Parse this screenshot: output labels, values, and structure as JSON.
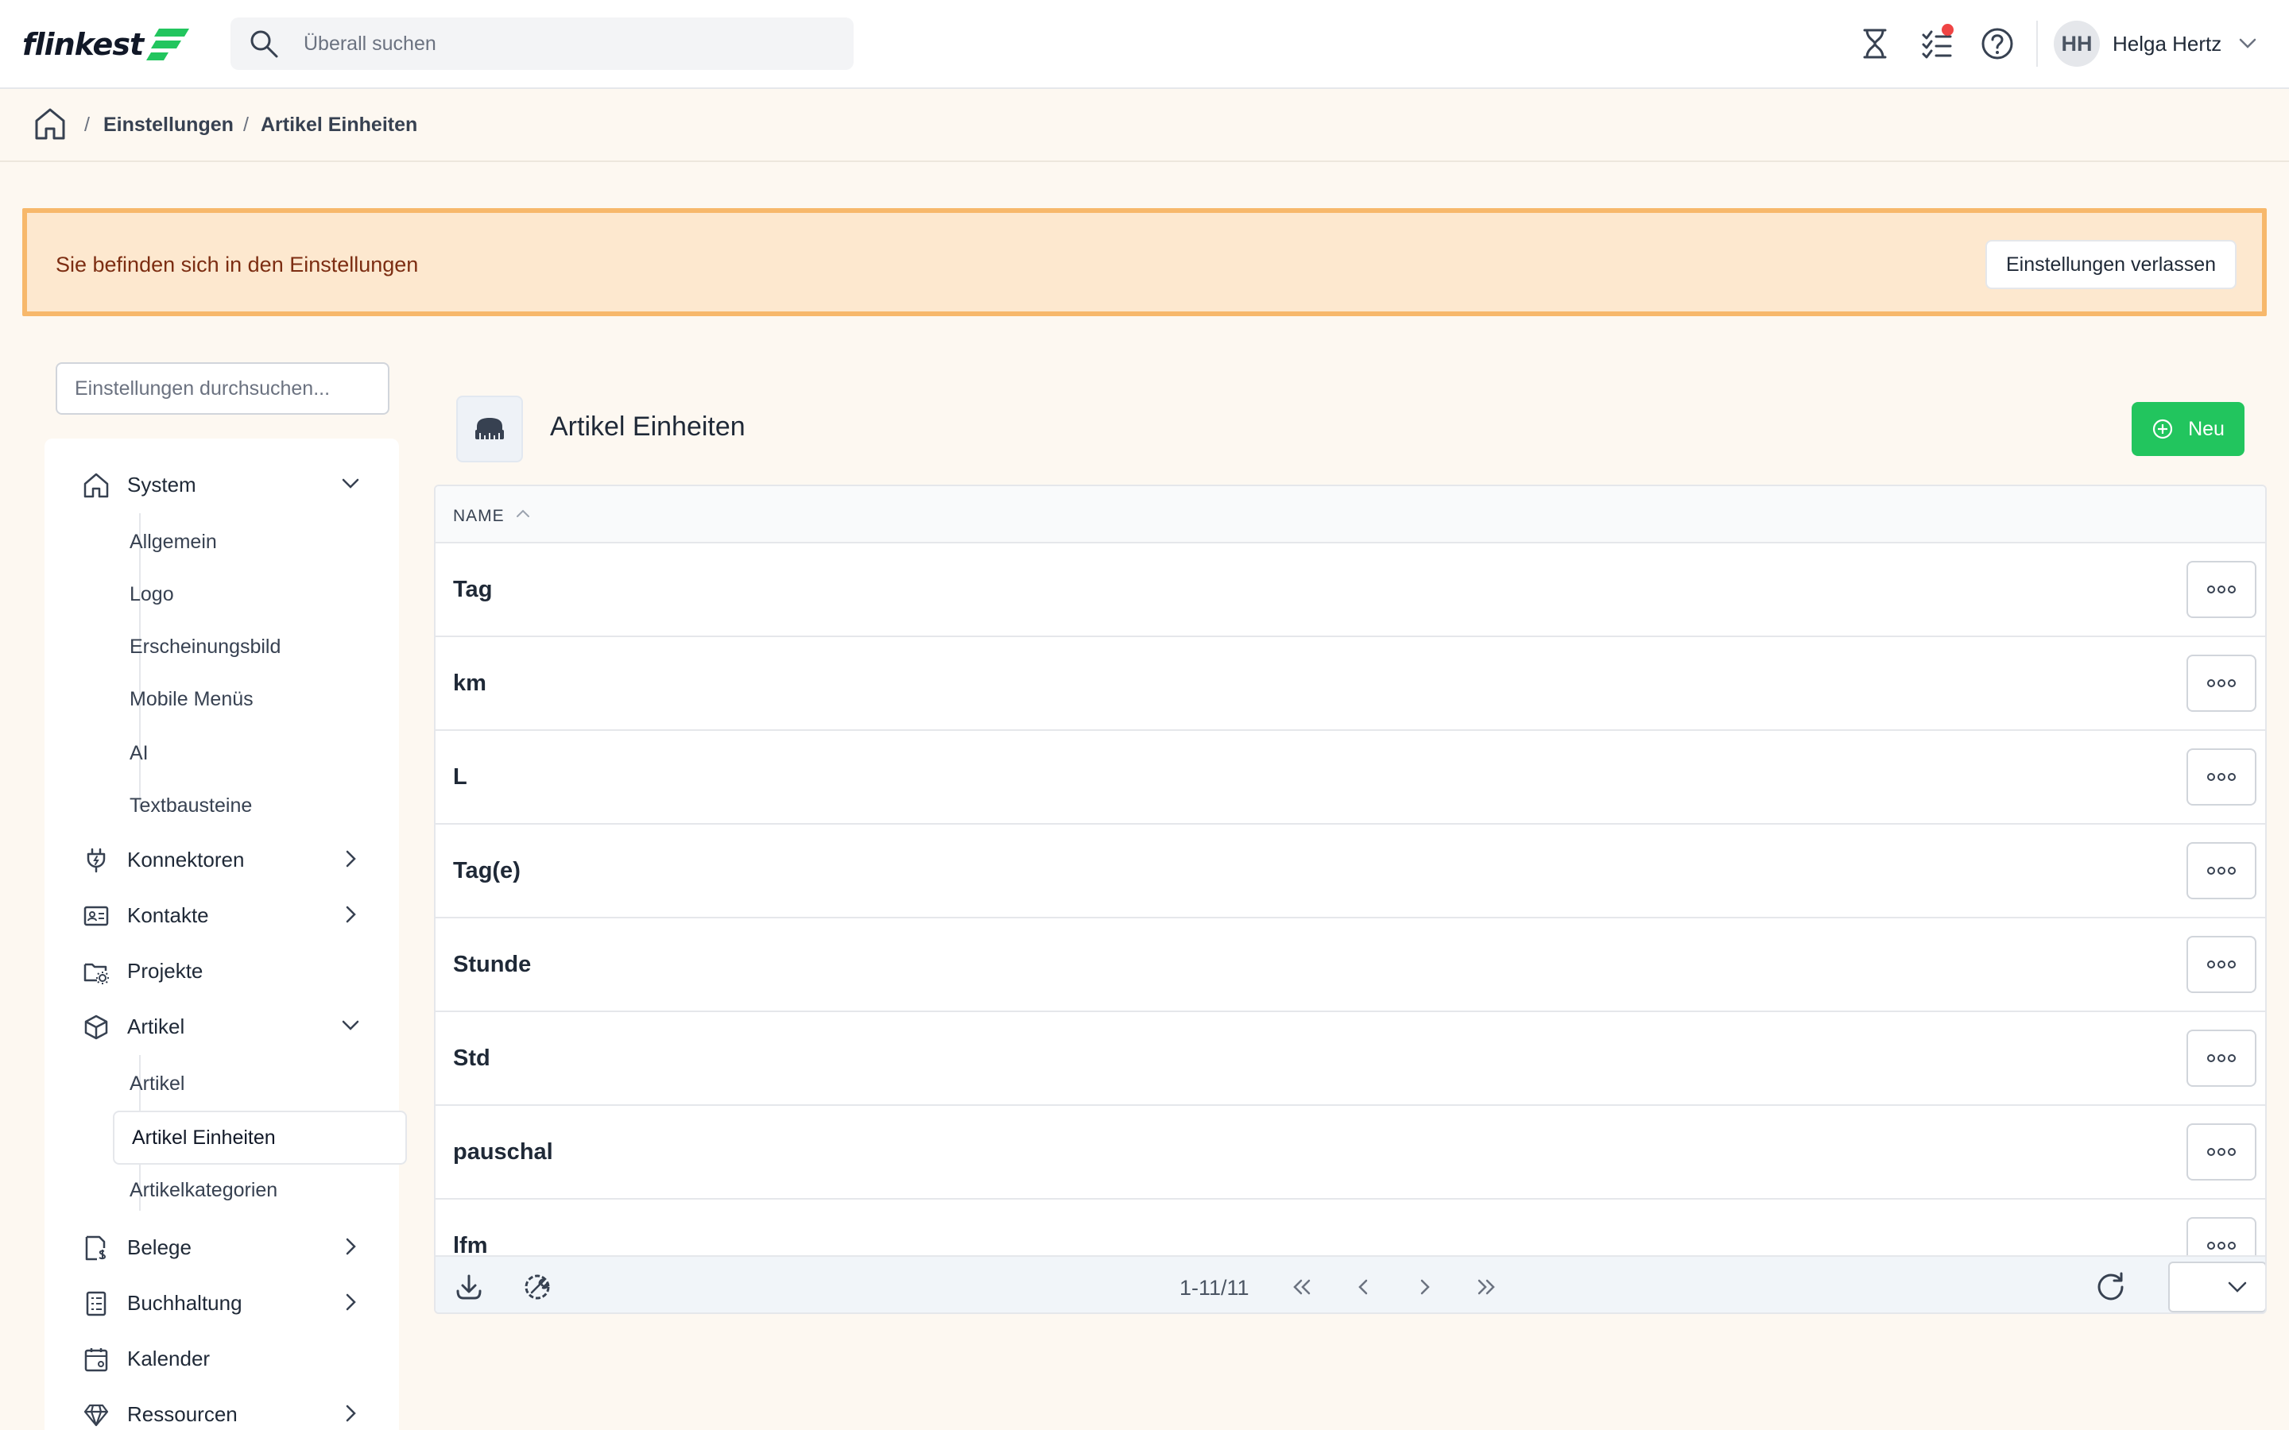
{
  "app": {
    "logo_text": "flinkest"
  },
  "search": {
    "placeholder": "Überall suchen"
  },
  "user": {
    "initials": "HH",
    "name": "Helga Hertz"
  },
  "top_icons": [
    "hourglass-icon",
    "tasks-icon",
    "help-icon"
  ],
  "breadcrumb": {
    "items": [
      "Einstellungen",
      "Artikel Einheiten"
    ],
    "separator": "/"
  },
  "notice": {
    "text": "Sie befinden sich in den Einstellungen",
    "button": "Einstellungen verlassen"
  },
  "sidebar": {
    "search_placeholder": "Einstellungen durchsuchen...",
    "sections": [
      {
        "label": "System",
        "icon": "home-icon",
        "expanded": true,
        "children": [
          "Allgemein",
          "Logo",
          "Erscheinungsbild",
          "Mobile Menüs",
          "AI",
          "Textbausteine"
        ]
      },
      {
        "label": "Konnektoren",
        "icon": "plug-icon",
        "expanded": false
      },
      {
        "label": "Kontakte",
        "icon": "contact-card-icon",
        "expanded": false
      },
      {
        "label": "Projekte",
        "icon": "folder-gear-icon"
      },
      {
        "label": "Artikel",
        "icon": "cube-icon",
        "expanded": true,
        "children": [
          "Artikel",
          "Artikel Einheiten",
          "Artikelkategorien"
        ],
        "active_child": "Artikel Einheiten"
      },
      {
        "label": "Belege",
        "icon": "receipt-icon",
        "expanded": false
      },
      {
        "label": "Buchhaltung",
        "icon": "ledger-icon",
        "expanded": false
      },
      {
        "label": "Kalender",
        "icon": "calendar-icon"
      },
      {
        "label": "Ressourcen",
        "icon": "diamond-icon",
        "expanded": false
      }
    ]
  },
  "main": {
    "title": "Artikel Einheiten",
    "new_button": "Neu",
    "table": {
      "column": "NAME",
      "rows": [
        "Tag",
        "km",
        "L",
        "Tag(e)",
        "Stunde",
        "Std",
        "pauschal",
        "lfm"
      ]
    },
    "pagination": {
      "range": "1-11/11"
    }
  },
  "colors": {
    "accent_green": "#22c55e",
    "notice_bg": "#fde8cf",
    "notice_border": "#f7b86b",
    "badge_red": "#ef4444",
    "page_bg": "#fdf8f1"
  }
}
